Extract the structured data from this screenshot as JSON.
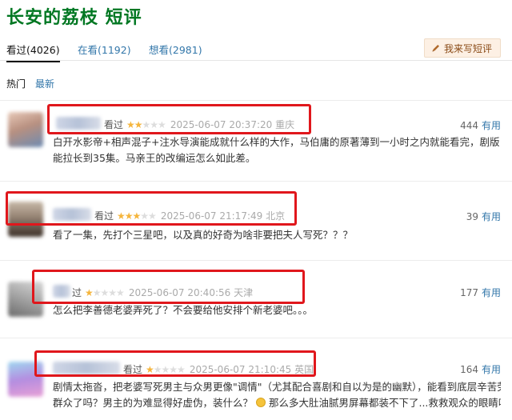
{
  "page": {
    "title": "长安的荔枝 短评"
  },
  "tabs": [
    {
      "label": "看过(4026)"
    },
    {
      "label": "在看(1192)"
    },
    {
      "label": "想看(2981)"
    }
  ],
  "write_button": {
    "label": "我来写短评",
    "icon": "pencil-icon"
  },
  "sorts": [
    {
      "label": "热门"
    },
    {
      "label": "最新"
    }
  ],
  "comments": [
    {
      "status": "看过",
      "rating": 2,
      "time": "2025-06-07 20:37:20 重庆",
      "votes": "444",
      "useful_label": "有用",
      "text": "白开水影帝+相声混子+注水导演能成就什么样的大作，马伯庸的原著薄到一小时之内就能看完，剧版能拉长到35集。马亲王的改编运怎么如此差。"
    },
    {
      "status": "看过",
      "rating": 3,
      "time": "2025-06-07 21:17:49 北京",
      "votes": "39",
      "useful_label": "有用",
      "text": "看了一集，先打个三星吧，以及真的好奇为啥非要把夫人写死？？？"
    },
    {
      "status": "过",
      "rating": 1,
      "time": "2025-06-07 20:40:56 天津",
      "votes": "177",
      "useful_label": "有用",
      "text": "怎么把李善德老婆弄死了？不会要给他安排个新老婆吧。。。"
    },
    {
      "status": "看过",
      "rating": 1,
      "time": "2025-06-07 21:10:45 英国",
      "votes": "164",
      "useful_label": "有用",
      "text_line1": "剧情太拖沓，把老婆写死男主与众男更像\"调情\"（尤其配合喜剧和自以为是的幽默），能看到底层辛苦劳动",
      "text_line2_a": "群众了吗？男主的为难显得好虚伪，装什么？",
      "text_line2_b": "那么多大肚油腻男屏幕都装不下了...救救观众的眼睛吧"
    }
  ],
  "colors": {
    "title": "#007722",
    "link": "#3377aa",
    "star": "#f5b53c",
    "highlight": "#e0171c"
  }
}
